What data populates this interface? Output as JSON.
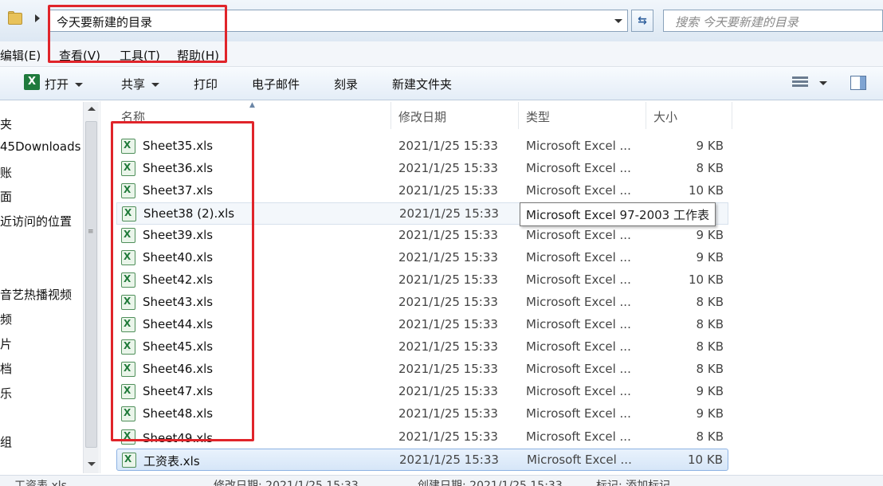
{
  "address_bar": {
    "path": "今天要新建的目录",
    "search_placeholder": "搜索 今天要新建的目录"
  },
  "menu": {
    "edit": "编辑(E)",
    "view": "查看(V)",
    "tools": "工具(T)",
    "help": "帮助(H)"
  },
  "toolbar": {
    "open": "打开",
    "share": "共享",
    "print": "打印",
    "email": "电子邮件",
    "burn": "刻录",
    "new_folder": "新建文件夹"
  },
  "nav_pane": {
    "items": [
      "夹",
      "45Downloads",
      "账",
      "面",
      "近访问的位置",
      "音艺热播视频",
      "频",
      "片",
      "档",
      "乐",
      "组"
    ]
  },
  "columns": {
    "name": "名称",
    "date": "修改日期",
    "type": "类型",
    "size": "大小"
  },
  "files": [
    {
      "name": "Sheet35.xls",
      "date": "2021/1/25 15:33",
      "type": "Microsoft Excel ...",
      "size": "9 KB"
    },
    {
      "name": "Sheet36.xls",
      "date": "2021/1/25 15:33",
      "type": "Microsoft Excel ...",
      "size": "8 KB"
    },
    {
      "name": "Sheet37.xls",
      "date": "2021/1/25 15:33",
      "type": "Microsoft Excel ...",
      "size": "10 KB"
    },
    {
      "name": "Sheet38 (2).xls",
      "date": "2021/1/25 15:33",
      "type": "",
      "size": ""
    },
    {
      "name": "Sheet39.xls",
      "date": "2021/1/25 15:33",
      "type": "Microsoft Excel ...",
      "size": "9 KB"
    },
    {
      "name": "Sheet40.xls",
      "date": "2021/1/25 15:33",
      "type": "Microsoft Excel ...",
      "size": "9 KB"
    },
    {
      "name": "Sheet42.xls",
      "date": "2021/1/25 15:33",
      "type": "Microsoft Excel ...",
      "size": "10 KB"
    },
    {
      "name": "Sheet43.xls",
      "date": "2021/1/25 15:33",
      "type": "Microsoft Excel ...",
      "size": "8 KB"
    },
    {
      "name": "Sheet44.xls",
      "date": "2021/1/25 15:33",
      "type": "Microsoft Excel ...",
      "size": "8 KB"
    },
    {
      "name": "Sheet45.xls",
      "date": "2021/1/25 15:33",
      "type": "Microsoft Excel ...",
      "size": "8 KB"
    },
    {
      "name": "Sheet46.xls",
      "date": "2021/1/25 15:33",
      "type": "Microsoft Excel ...",
      "size": "8 KB"
    },
    {
      "name": "Sheet47.xls",
      "date": "2021/1/25 15:33",
      "type": "Microsoft Excel ...",
      "size": "9 KB"
    },
    {
      "name": "Sheet48.xls",
      "date": "2021/1/25 15:33",
      "type": "Microsoft Excel ...",
      "size": "9 KB"
    },
    {
      "name": "Sheet49.xls",
      "date": "2021/1/25 15:33",
      "type": "Microsoft Excel ...",
      "size": "8 KB"
    },
    {
      "name": "工资表.xls",
      "date": "2021/1/25 15:33",
      "type": "Microsoft Excel ...",
      "size": "10 KB"
    }
  ],
  "tooltip": "Microsoft Excel 97-2003 工作表",
  "status_bar": {
    "filename": "工资表.xls",
    "modified": "修改日期: 2021/1/25 15:33",
    "created": "创建日期: 2021/1/25 15:33",
    "hint": "标记: 添加标记"
  },
  "colors": {
    "annotation_red": "#e0242a",
    "selection_blue": "#d6e6f8",
    "excel_green": "#1f7a3c"
  }
}
